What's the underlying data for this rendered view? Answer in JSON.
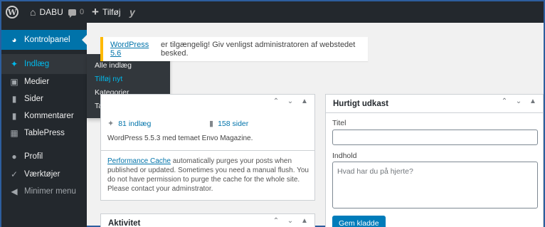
{
  "adminbar": {
    "site_name": "DABU",
    "comments_count": "0",
    "new_label": "Tilføj"
  },
  "sidebar": {
    "items": [
      {
        "label": "Kontrolpanel",
        "icon": "dashboard-icon"
      },
      {
        "label": "Indlæg",
        "icon": "pin-icon"
      },
      {
        "label": "Medier",
        "icon": "media-icon"
      },
      {
        "label": "Sider",
        "icon": "page-icon"
      },
      {
        "label": "Kommentarer",
        "icon": "comment-icon"
      },
      {
        "label": "TablePress",
        "icon": "table-icon"
      },
      {
        "label": "Profil",
        "icon": "user-icon"
      },
      {
        "label": "Værktøjer",
        "icon": "wrench-icon"
      },
      {
        "label": "Minimer menu",
        "icon": "collapse-icon"
      }
    ],
    "flyout": [
      "Alle indlæg",
      "Tilføj nyt",
      "Kategorier",
      "Tags"
    ]
  },
  "notice": {
    "link": "WordPress 5.6",
    "text": "er tilgængelig! Giv venligst administratoren af webstedet besked."
  },
  "glance": {
    "posts": "81 indlæg",
    "pages": "158 sider",
    "version": "WordPress 5.5.3 med temaet Envo Magazine.",
    "cache_link": "Performance Cache",
    "cache_text": "automatically purges your posts when published or updated. Sometimes you need a manual flush. You do not have permission to purge the cache for the whole site. Please contact your adminstrator."
  },
  "activity": {
    "title": "Aktivitet"
  },
  "quick_draft": {
    "title": "Hurtigt udkast",
    "title_label": "Titel",
    "content_label": "Indhold",
    "content_placeholder": "Hvad har du på hjerte?",
    "save_label": "Gem kladde"
  },
  "colors": {
    "adminbar_bg": "#23282d",
    "accent": "#0073aa",
    "notice_border": "#ffb900",
    "button": "#007cba"
  }
}
